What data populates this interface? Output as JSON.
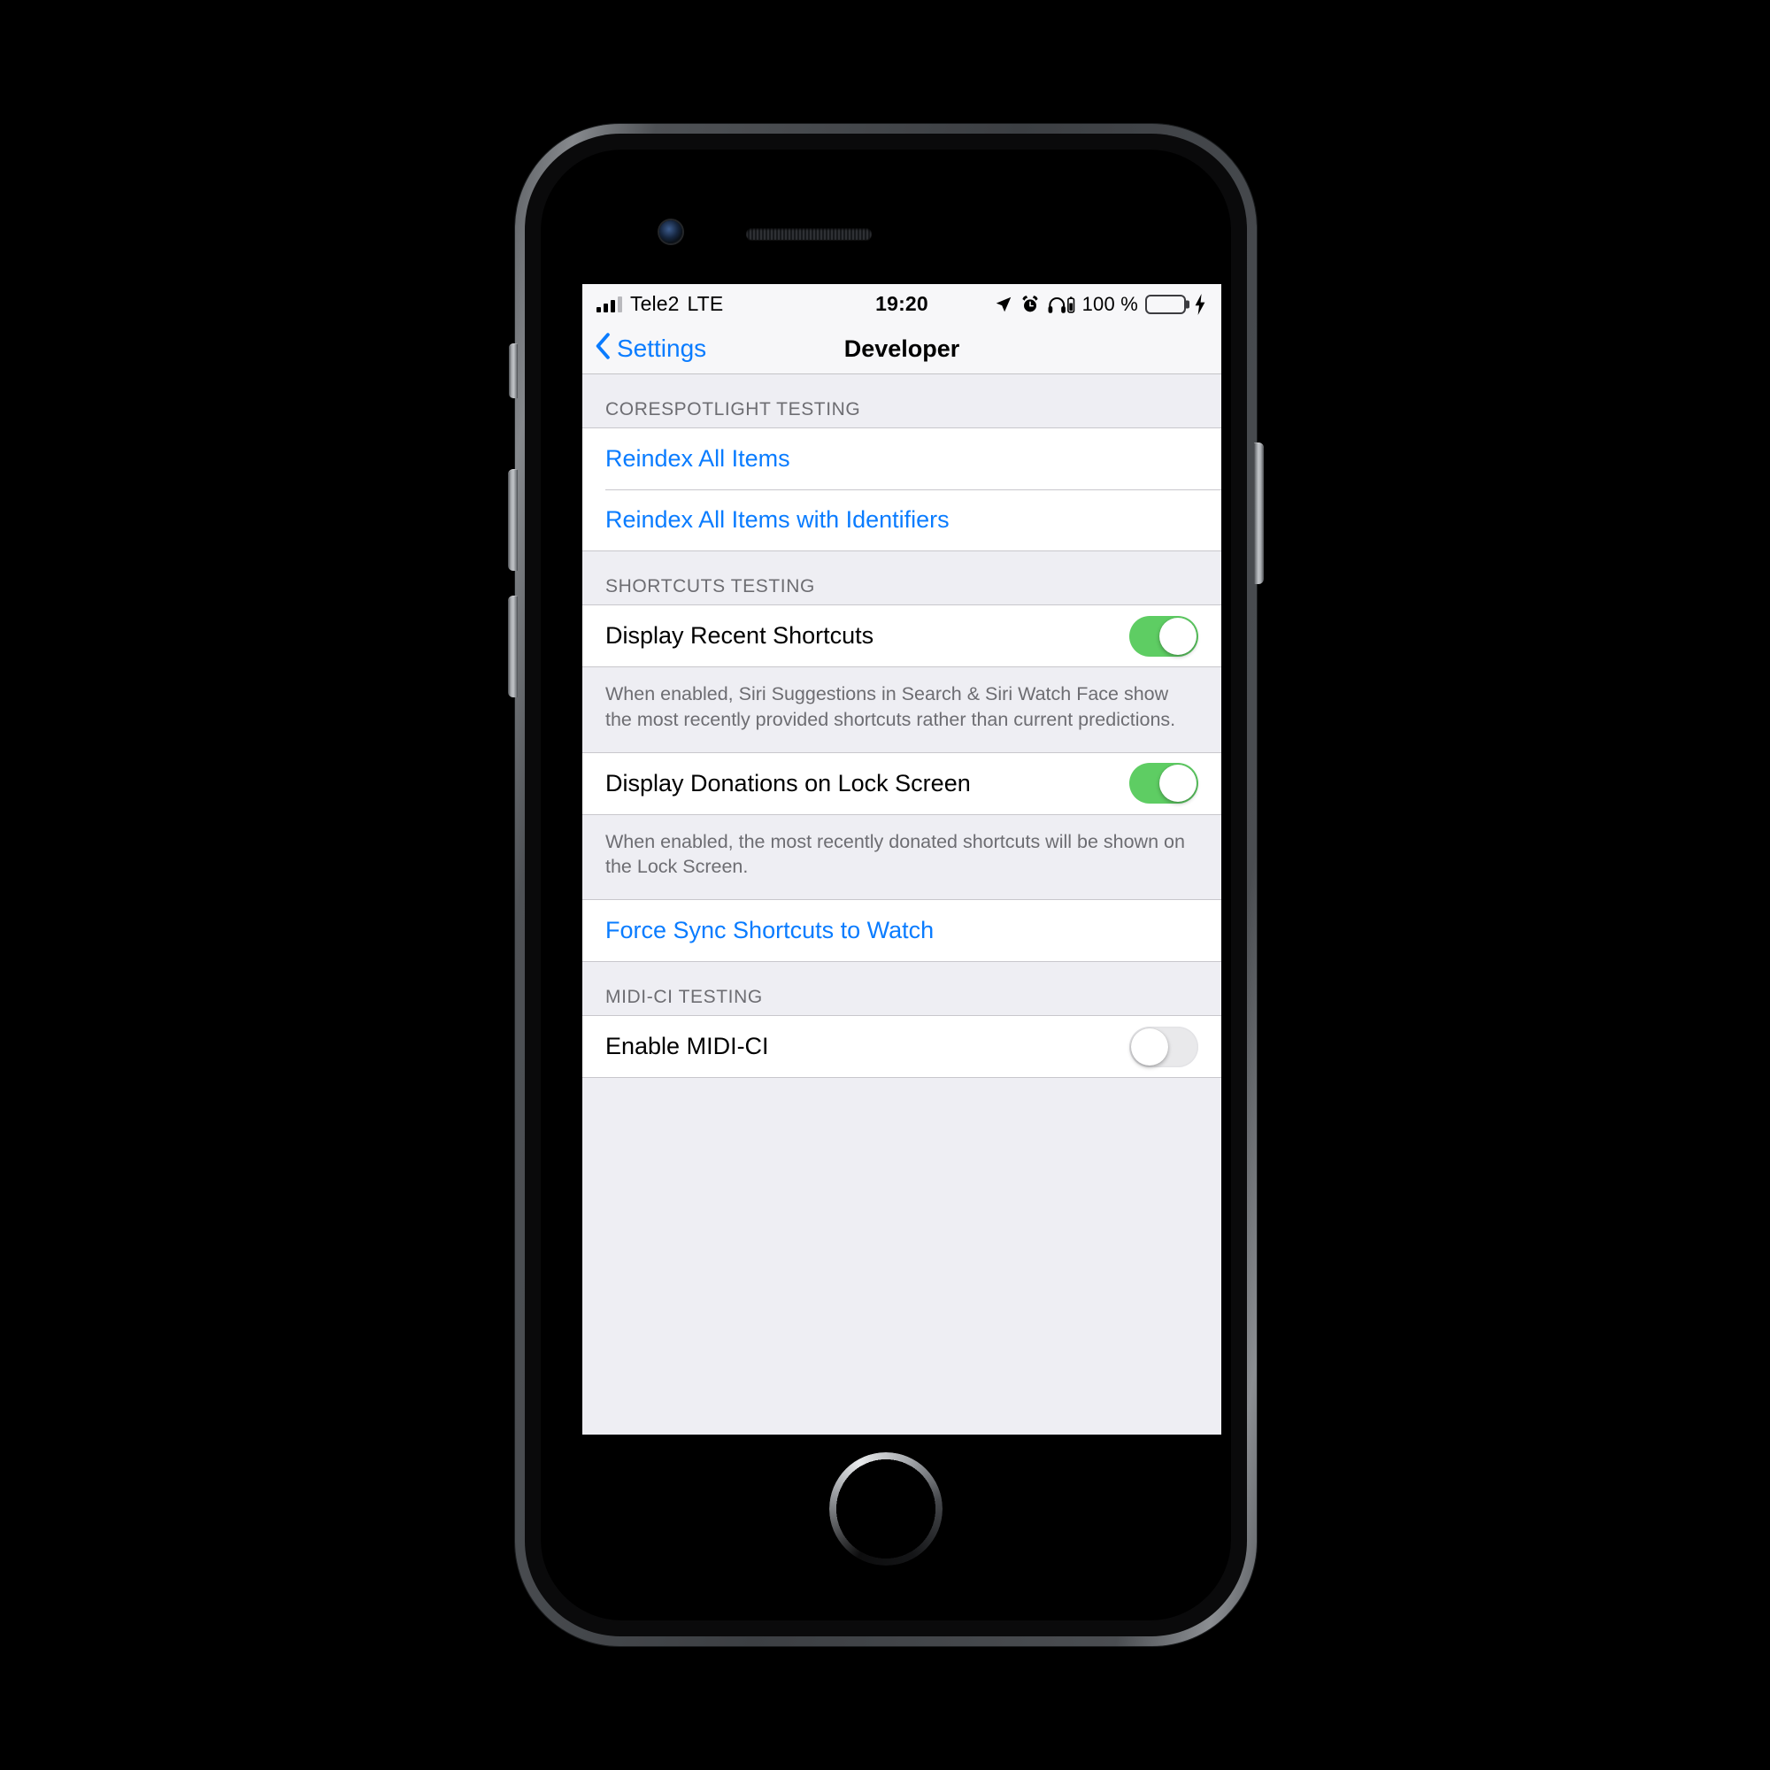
{
  "status_bar": {
    "signal_icon": "signal-bars-icon",
    "signal_bars_filled": 3,
    "signal_bars_total": 4,
    "carrier": "Tele2",
    "radio_type": "LTE",
    "time": "19:20",
    "location_icon": "location-arrow-icon",
    "alarm_icon": "alarm-clock-icon",
    "headphones_icon": "headphones-battery-icon",
    "battery_percent": "100 %",
    "battery_icon": "battery-full-icon",
    "charging_icon": "lightning-bolt-icon",
    "battery_color": "#5ecd63"
  },
  "nav_bar": {
    "back_icon": "chevron-left-icon",
    "back_label": "Settings",
    "title": "Developer",
    "tint_color": "#0a7cff"
  },
  "sections": [
    {
      "header": "CORESPOTLIGHT TESTING",
      "rows": [
        {
          "label": "Reindex All Items",
          "type": "action"
        },
        {
          "label": "Reindex All Items with Identifiers",
          "type": "action"
        }
      ]
    },
    {
      "header": "SHORTCUTS TESTING",
      "rows": [
        {
          "label": "Display Recent Shortcuts",
          "type": "toggle",
          "value": "on"
        }
      ],
      "footer": "When enabled, Siri Suggestions in Search & Siri Watch Face show the most recently provided shortcuts rather than current predictions."
    },
    {
      "header": "",
      "rows": [
        {
          "label": "Display Donations on Lock Screen",
          "type": "toggle",
          "value": "on"
        }
      ],
      "footer": "When enabled, the most recently donated shortcuts will be shown on the Lock Screen."
    },
    {
      "header": "",
      "rows": [
        {
          "label": "Force Sync Shortcuts to Watch",
          "type": "action"
        }
      ]
    },
    {
      "header": "MIDI-CI TESTING",
      "rows": [
        {
          "label": "Enable MIDI-CI",
          "type": "toggle",
          "value": "off"
        }
      ]
    }
  ],
  "hardware": {
    "camera": "front-camera",
    "speaker": "earpiece-speaker",
    "home_button": "home-button",
    "mute_switch": "mute-switch",
    "volume_up": "volume-up-button",
    "volume_down": "volume-down-button",
    "power": "power-button"
  }
}
